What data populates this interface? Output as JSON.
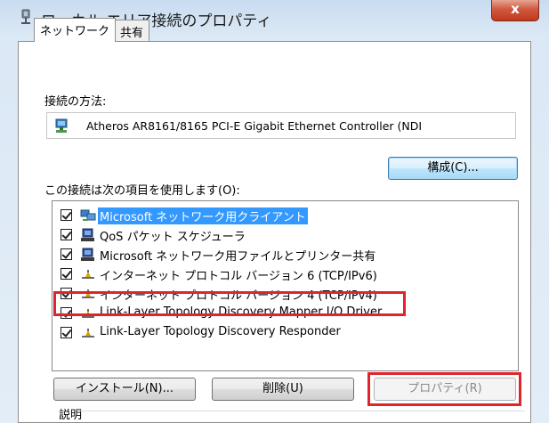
{
  "window": {
    "title": "ローカル エリア接続のプロパティ",
    "close_label": "x"
  },
  "tabs": [
    {
      "label": "ネットワーク",
      "active": true
    },
    {
      "label": "共有",
      "active": false
    }
  ],
  "connect_using": {
    "label": "接続の方法:",
    "adapter": "Atheros AR8161/8165 PCI-E Gigabit Ethernet Controller (NDI"
  },
  "configure_button": "構成(C)...",
  "items_label": "この接続は次の項目を使用します(O):",
  "items": [
    {
      "label": "Microsoft ネットワーク用クライアント",
      "checked": true,
      "selected": true,
      "icon": "network-client-icon"
    },
    {
      "label": "QoS パケット スケジューラ",
      "checked": true,
      "selected": false,
      "icon": "computer-service-icon"
    },
    {
      "label": "Microsoft ネットワーク用ファイルとプリンター共有",
      "checked": true,
      "selected": false,
      "icon": "computer-service-icon"
    },
    {
      "label": "インターネット プロトコル バージョン 6 (TCP/IPv6)",
      "checked": true,
      "selected": false,
      "icon": "protocol-icon"
    },
    {
      "label": "インターネット プロトコル バージョン 4 (TCP/IPv4)",
      "checked": true,
      "selected": false,
      "icon": "protocol-icon"
    },
    {
      "label": "Link-Layer Topology Discovery Mapper I/O Driver",
      "checked": true,
      "selected": false,
      "icon": "protocol-icon"
    },
    {
      "label": "Link-Layer Topology Discovery Responder",
      "checked": true,
      "selected": false,
      "icon": "protocol-icon"
    }
  ],
  "buttons": {
    "install": "インストール(N)...",
    "uninstall": "削除(U)",
    "properties": "プロパティ(R)"
  },
  "description_label": "説明",
  "colors": {
    "highlight": "#e0242b",
    "selection": "#3399ff",
    "close_button": "#c0391e"
  }
}
